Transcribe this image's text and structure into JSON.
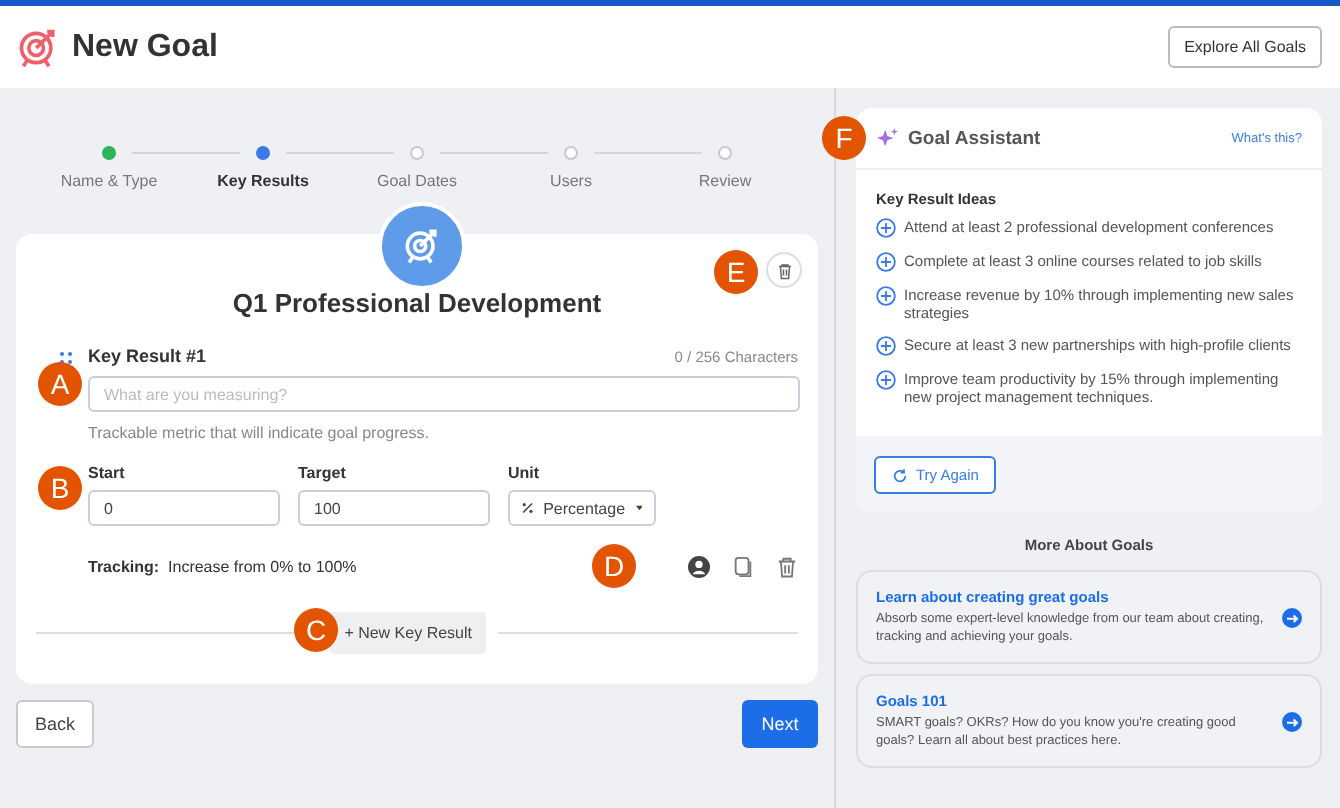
{
  "header": {
    "title": "New Goal",
    "button": "Explore All Goals"
  },
  "steps": [
    {
      "label": "Name & Type",
      "completed": true,
      "selected": false
    },
    {
      "label": "Key Results",
      "completed": false,
      "selected": true
    },
    {
      "label": "Goal Dates",
      "completed": false,
      "selected": false
    },
    {
      "label": "Users",
      "completed": false,
      "selected": false
    },
    {
      "label": "Review",
      "completed": false,
      "selected": false
    }
  ],
  "card": {
    "title": "Q1 Professional Development",
    "callout": "E",
    "key_result": {
      "label": "Key Result #1",
      "counter": "0 / 256 Characters",
      "callout_field": "A",
      "placeholder": "What are you measuring?",
      "hint": "Trackable metric that will indicate goal progress.",
      "callout_values": "B",
      "start": {
        "label": "Start",
        "value": "0"
      },
      "target": {
        "label": "Target",
        "value": "100"
      },
      "unit": {
        "label": "Unit",
        "value": "Percentage"
      },
      "tracking_label": "Tracking:",
      "tracking_text": "Increase from 0% to 100%",
      "callout_actions": "D"
    },
    "add_button": "+ New Key Result",
    "callout_add": "C"
  },
  "footer": {
    "back": "Back",
    "next": "Next"
  },
  "assistant": {
    "callout": "F",
    "title": "Goal Assistant",
    "link": "What's this?",
    "ideas_title": "Key Result Ideas",
    "ideas": [
      "Attend at least 2 professional development conferences",
      "Complete at least 3 online courses related to job skills",
      "Increase revenue by 10% through implementing new sales strategies",
      "Secure at least 3 new partnerships with high-profile clients",
      "Improve team productivity by 15% through implementing new project management techniques."
    ],
    "retry": "Try Again"
  },
  "more": {
    "title": "More About Goals",
    "articles": [
      {
        "title": "Learn about creating great goals",
        "description": "Absorb some expert-level knowledge from our team about creating, tracking and achieving your goals."
      },
      {
        "title": "Goals 101",
        "description": "SMART goals? OKRs? How do you know you're creating good goals? Learn all about best practices here."
      }
    ]
  }
}
